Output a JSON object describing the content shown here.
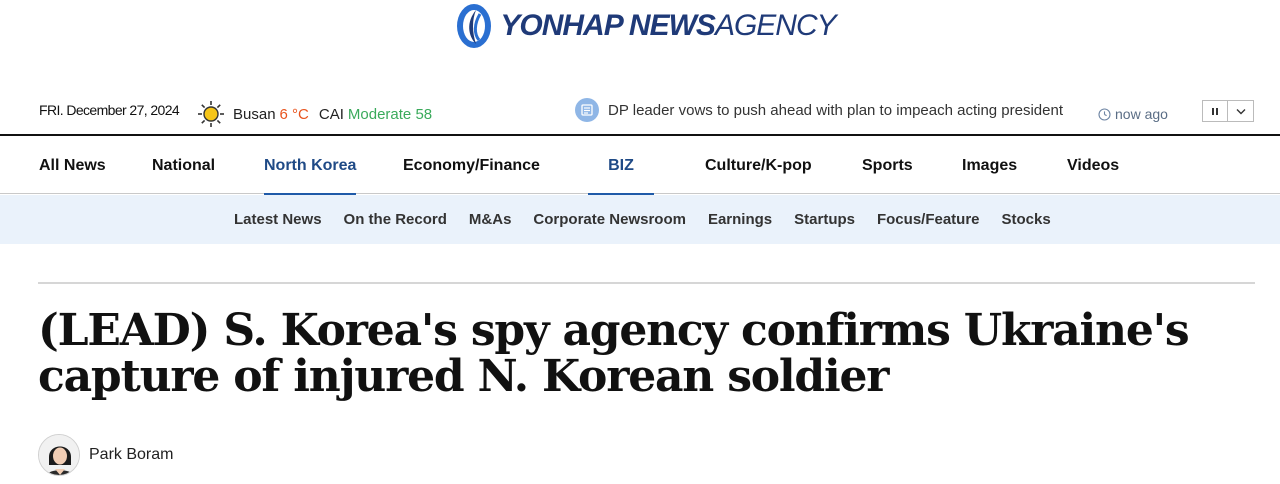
{
  "brand": {
    "logo_bold": "YONHAP NEWS",
    "logo_light": "AGENCY",
    "colors": {
      "navy": "#1f3a78",
      "accent_blue": "#1f5aa8",
      "temp_orange": "#e8541e",
      "cai_green": "#3aaa5b",
      "subnav_bg": "#eaf2fb"
    }
  },
  "infobar": {
    "date": "FRI. December 27, 2024",
    "weather": {
      "icon": "sun-icon",
      "city": "Busan",
      "temp": "6 °C",
      "cai_label": "CAI",
      "cai_value": "Moderate 58"
    },
    "ticker": {
      "icon": "news-list-icon",
      "headline": "DP leader vows to push ahead with plan to impeach acting president",
      "time": "now ago"
    },
    "controls": {
      "pause": "pause-icon",
      "expand": "chevron-down-icon"
    }
  },
  "nav": {
    "items": [
      {
        "label": "All News"
      },
      {
        "label": "National"
      },
      {
        "label": "North Korea"
      },
      {
        "label": "Economy/Finance"
      },
      {
        "label": "BIZ"
      },
      {
        "label": "Culture/K-pop"
      },
      {
        "label": "Sports"
      },
      {
        "label": "Images"
      },
      {
        "label": "Videos"
      }
    ],
    "active": "North Korea"
  },
  "subnav": {
    "items": [
      {
        "label": "Latest News"
      },
      {
        "label": "On the Record"
      },
      {
        "label": "M&As"
      },
      {
        "label": "Corporate Newsroom"
      },
      {
        "label": "Earnings"
      },
      {
        "label": "Startups"
      },
      {
        "label": "Focus/Feature"
      },
      {
        "label": "Stocks"
      }
    ]
  },
  "article": {
    "headline": "(LEAD) S. Korea's spy agency confirms Ukraine's capture of injured N. Korean soldier",
    "author": "Park Boram"
  }
}
